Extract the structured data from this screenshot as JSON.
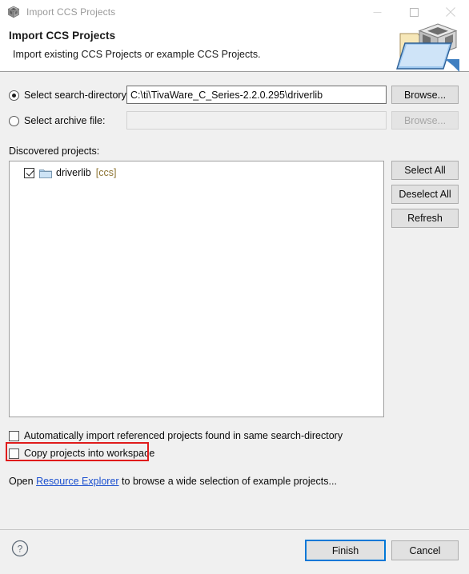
{
  "window": {
    "title": "Import CCS Projects",
    "app_icon": "ccs-cube-icon",
    "controls": {
      "minimize": "minimize-icon",
      "maximize": "maximize-icon",
      "close": "close-icon"
    }
  },
  "header": {
    "title": "Import CCS Projects",
    "description": "Import existing CCS Projects or example CCS Projects.",
    "graphic": "import-folder-cube-icon"
  },
  "form": {
    "search_directory": {
      "radio_label": "Select search-directory:",
      "selected": true,
      "value": "C:\\ti\\TivaWare_C_Series-2.2.0.295\\driverlib",
      "placeholder": "",
      "browse_label": "Browse...",
      "browse_enabled": true
    },
    "archive_file": {
      "radio_label": "Select archive file:",
      "selected": false,
      "value": "",
      "placeholder": "",
      "browse_label": "Browse...",
      "browse_enabled": false
    }
  },
  "discovered": {
    "label": "Discovered projects:",
    "items": [
      {
        "name": "driverlib",
        "tag": "[ccs]",
        "checked": true,
        "icon": "folder-icon"
      }
    ],
    "buttons": {
      "select_all": "Select All",
      "deselect_all": "Deselect All",
      "refresh": "Refresh"
    }
  },
  "options": [
    {
      "label": "Automatically import referenced projects found in same search-directory",
      "checked": false,
      "highlighted": false
    },
    {
      "label": "Copy projects into workspace",
      "checked": false,
      "highlighted": true
    }
  ],
  "link_line": {
    "prefix": "Open ",
    "link": "Resource Explorer",
    "suffix": " to browse a wide selection of example projects..."
  },
  "footer": {
    "help_icon": "help-question-icon",
    "finish_label": "Finish",
    "cancel_label": "Cancel"
  },
  "colors": {
    "accent": "#0078d7",
    "highlight": "#e01b1b",
    "link": "#1a4fcf",
    "tag": "#8d7433",
    "dialog_bg": "#f0f0f0"
  }
}
